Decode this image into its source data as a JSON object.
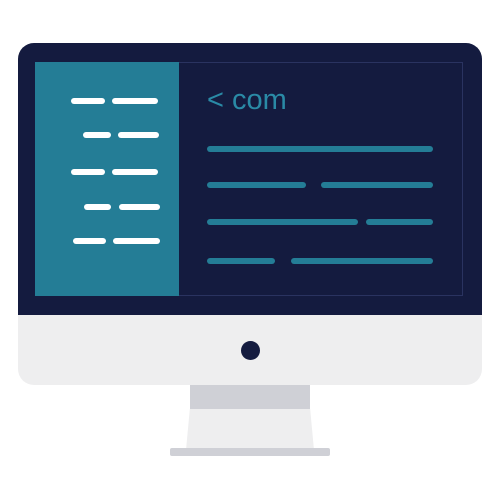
{
  "illustration": {
    "subject": "desktop-monitor-code-editor",
    "colors": {
      "screen_bezel": "#141b3f",
      "sidebar": "#247d96",
      "code_text": "#2a8aa6",
      "chin": "#eeeeef",
      "stand_shadow": "#cfd0d6"
    }
  },
  "editor": {
    "prompt_text": "< com"
  },
  "icons": [
    "power-button-icon"
  ]
}
